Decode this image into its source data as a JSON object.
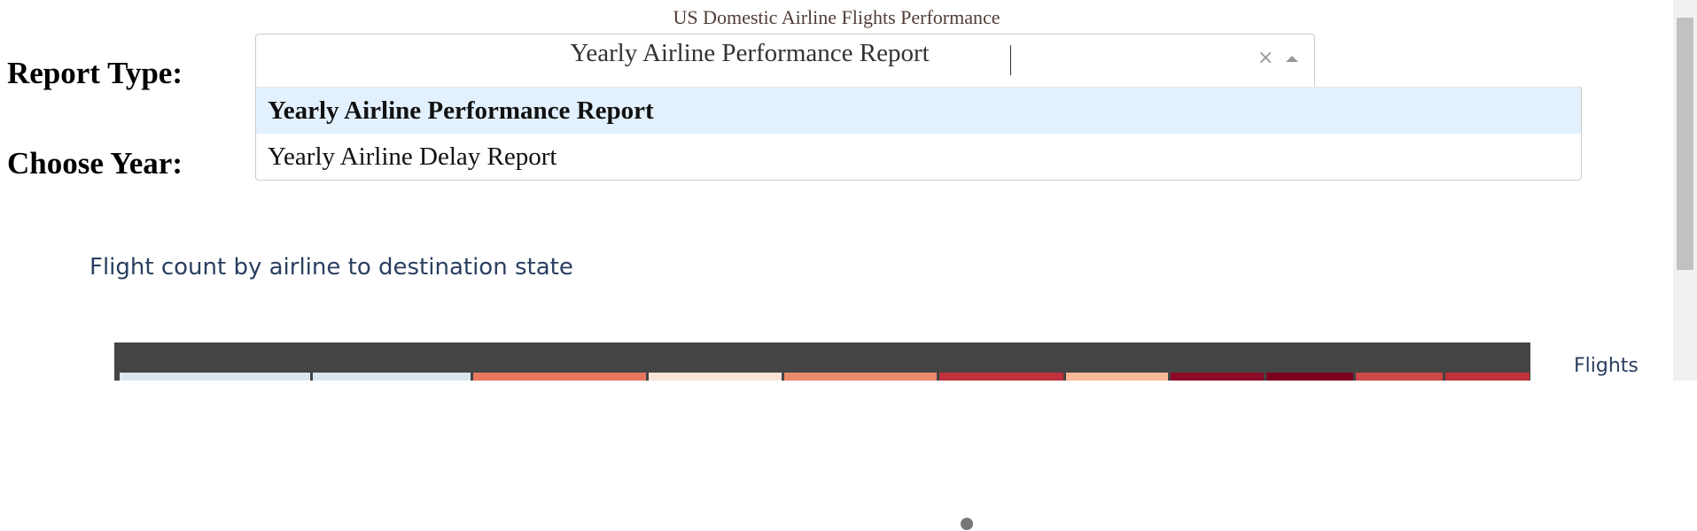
{
  "header": {
    "title": "US Domestic Airline Flights Performance"
  },
  "form": {
    "report_type_label": "Report Type:",
    "year_label": "Choose Year:",
    "report_dropdown": {
      "value": "Yearly Airline Performance Report",
      "clear_symbol": "×",
      "options": [
        {
          "label": "Yearly Airline Performance Report",
          "selected": true
        },
        {
          "label": "Yearly Airline Delay Report",
          "selected": false
        }
      ]
    }
  },
  "graph": {
    "title": "Flight count by airline to destination state",
    "colorbar_title": "Flights",
    "background_color": "#444444",
    "cell_colors": [
      "#d9e6ef",
      "#d9e6ef",
      "#e8775f",
      "#fbe2d7",
      "#ec8b6b",
      "#c0313c",
      "#f8b899",
      "#8b0b26",
      "#7a0020",
      "#cf4a46",
      "#c0313c"
    ],
    "cell_widths": [
      215,
      178,
      195,
      150,
      172,
      140,
      115,
      105,
      98,
      98,
      95
    ]
  }
}
